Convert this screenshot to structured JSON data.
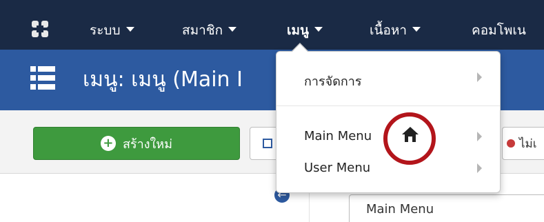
{
  "nav": {
    "items": [
      {
        "label": "ระบบ",
        "has_caret": true
      },
      {
        "label": "สมาชิก",
        "has_caret": true
      },
      {
        "label": "เมนู",
        "has_caret": true
      },
      {
        "label": "เนื้อหา",
        "has_caret": true
      },
      {
        "label": "คอมโพเน",
        "has_caret": false
      }
    ],
    "active_index": 2
  },
  "page": {
    "title": "เมนู: เมนู (Main I"
  },
  "toolbar": {
    "new_label": "สร้างใหม่",
    "unpublish_label": "ไม่เ"
  },
  "dropdown": {
    "header": "การจัดการ",
    "items": [
      {
        "label": "Main Menu",
        "home_icon": true
      },
      {
        "label": "User Menu",
        "home_icon": false
      }
    ]
  },
  "filter": {
    "selected_menu": "Main Menu"
  },
  "colors": {
    "topnav": "#1a2a45",
    "titlebar": "#2d5aa0",
    "new_button": "#3e9a3e",
    "highlight_ring": "#b3151b"
  },
  "icons": [
    "joomla-logo-icon",
    "list-icon",
    "plus-circle-icon",
    "edit-icon",
    "unpublish-icon",
    "back-arrow-icon",
    "home-icon",
    "chevron-right-icon"
  ]
}
